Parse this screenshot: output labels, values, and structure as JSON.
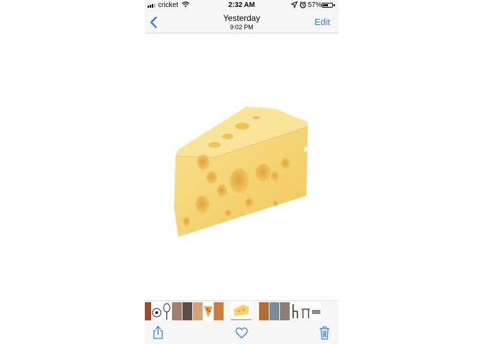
{
  "status_bar": {
    "carrier": "cricket",
    "time": "2:32 AM",
    "battery_percent": "57%",
    "battery_level": 0.57,
    "signal_bars": 3
  },
  "nav": {
    "title": "Yesterday",
    "subtitle": "9:02 PM",
    "edit_label": "Edit"
  },
  "icons": {
    "back": "chevron-left-icon",
    "share": "share-icon",
    "favorite": "heart-icon",
    "delete": "trash-icon"
  },
  "colors": {
    "accent": "#2d7cf6",
    "bar_background": "#f7f7f7",
    "cheese": "#f6d36f"
  }
}
